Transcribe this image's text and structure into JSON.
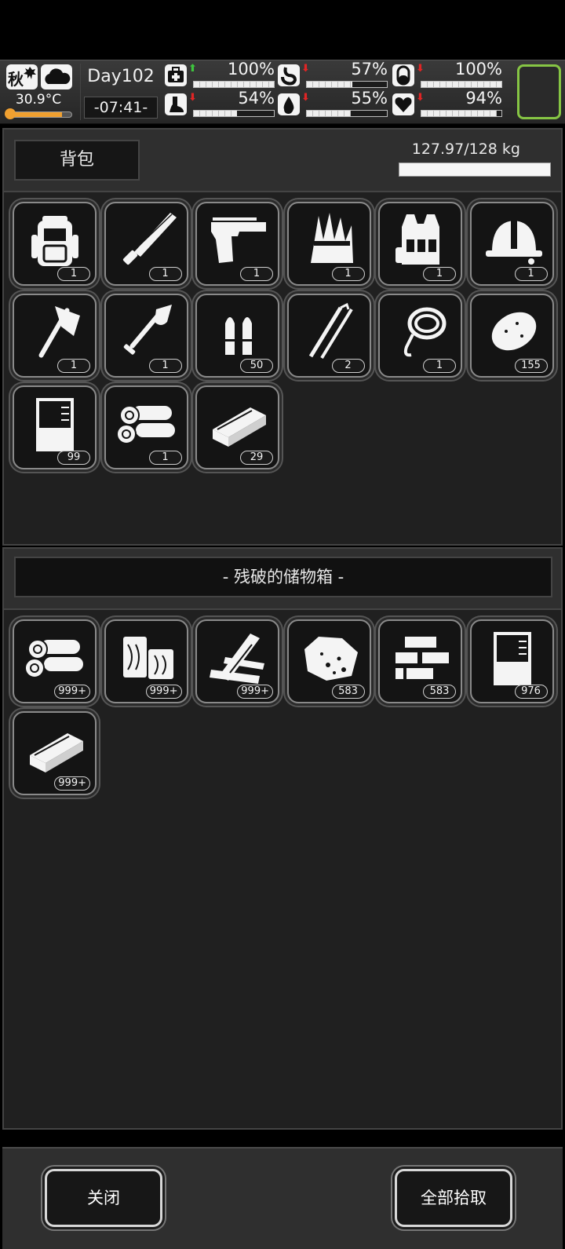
{
  "hud": {
    "season": "秋",
    "temperature": "30.9°C",
    "temperature_level": 0.85,
    "day": "Day102",
    "time": "-07:41-",
    "stats": [
      {
        "name": "health",
        "icon": "medkit-icon",
        "trend": "up",
        "trend_symbol": "⬆",
        "value": "100%",
        "level": 1.0
      },
      {
        "name": "hunger",
        "icon": "stomach-icon",
        "trend": "down",
        "trend_symbol": "⬇",
        "value": "57%",
        "level": 0.57
      },
      {
        "name": "energy",
        "icon": "capsule-icon",
        "trend": "down",
        "trend_symbol": "⬇",
        "value": "100%",
        "level": 1.0
      },
      {
        "name": "stamina",
        "icon": "foot-icon",
        "trend": "down",
        "trend_symbol": "⬇",
        "value": "54%",
        "level": 0.54
      },
      {
        "name": "thirst",
        "icon": "water-drop-icon",
        "trend": "down",
        "trend_symbol": "⬇",
        "value": "55%",
        "level": 0.55
      },
      {
        "name": "mood",
        "icon": "heart-icon",
        "trend": "down",
        "trend_symbol": "⬇",
        "value": "94%",
        "level": 0.94
      }
    ],
    "accent_color": "#86c544"
  },
  "backpack": {
    "title": "背包",
    "weight": "127.97/128 kg",
    "weight_level": 0.9998,
    "items": [
      {
        "icon": "backpack-icon",
        "qty": "1"
      },
      {
        "icon": "machete-icon",
        "qty": "1"
      },
      {
        "icon": "pistol-icon",
        "qty": "1"
      },
      {
        "icon": "straw-bundle-icon",
        "qty": "1"
      },
      {
        "icon": "tactical-vest-icon",
        "qty": "1"
      },
      {
        "icon": "hard-hat-icon",
        "qty": "1"
      },
      {
        "icon": "axe-icon",
        "qty": "1"
      },
      {
        "icon": "shovel-icon",
        "qty": "1"
      },
      {
        "icon": "bullets-icon",
        "qty": "50"
      },
      {
        "icon": "lockpick-icon",
        "qty": "2"
      },
      {
        "icon": "rope-hook-icon",
        "qty": "1"
      },
      {
        "icon": "potato-icon",
        "qty": "155"
      },
      {
        "icon": "beaker-icon",
        "qty": "99"
      },
      {
        "icon": "logs-icon",
        "qty": "1"
      },
      {
        "icon": "iron-ingot-icon",
        "qty": "29"
      }
    ]
  },
  "storage": {
    "title": "- 残破的储物箱 -",
    "items": [
      {
        "icon": "logs-icon",
        "qty": "999+"
      },
      {
        "icon": "wood-blocks-icon",
        "qty": "999+"
      },
      {
        "icon": "planks-icon",
        "qty": "999+"
      },
      {
        "icon": "ore-icon",
        "qty": "583"
      },
      {
        "icon": "bricks-icon",
        "qty": "583"
      },
      {
        "icon": "beaker-icon",
        "qty": "976"
      },
      {
        "icon": "iron-ingot-icon",
        "qty": "999+"
      }
    ]
  },
  "buttons": {
    "close": "关闭",
    "take_all": "全部拾取"
  }
}
